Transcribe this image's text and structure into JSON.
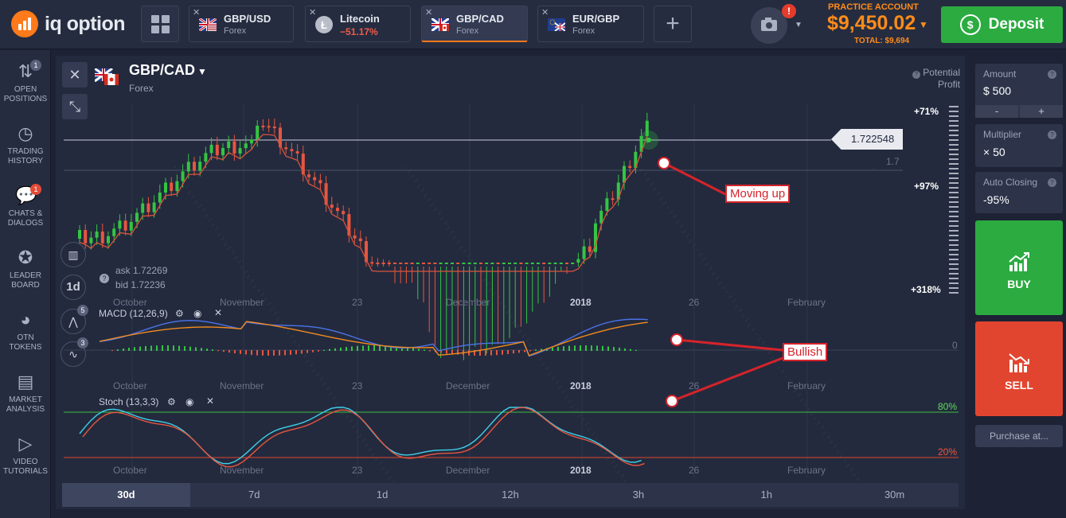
{
  "brand": {
    "name": "iq option"
  },
  "header": {
    "tabs": [
      {
        "name": "GBP/USD",
        "sub": "Forex"
      },
      {
        "name": "Litecoin",
        "sub": "−51.17%"
      },
      {
        "name": "GBP/CAD",
        "sub": "Forex"
      },
      {
        "name": "EUR/GBP",
        "sub": "Forex"
      }
    ],
    "alert_badge": "!",
    "account_label": "PRACTICE ACCOUNT",
    "balance": "$9,450.02",
    "total": "TOTAL: $9,694",
    "deposit_label": "Deposit"
  },
  "sidebar": {
    "items": [
      {
        "label": "OPEN POSITIONS",
        "icon": "arrows-icon",
        "badge": "1"
      },
      {
        "label": "TRADING HISTORY",
        "icon": "clock-history-icon",
        "badge": ""
      },
      {
        "label": "CHATS & DIALOGS",
        "icon": "chat-icon",
        "badge": "1"
      },
      {
        "label": "LEADER BOARD",
        "icon": "leader-icon",
        "badge": ""
      },
      {
        "label": "OTN TOKENS",
        "icon": "token-icon",
        "badge": ""
      },
      {
        "label": "MARKET ANALYSIS",
        "icon": "news-icon",
        "badge": ""
      },
      {
        "label": "VIDEO TUTORIALS",
        "icon": "play-icon",
        "badge": ""
      }
    ]
  },
  "chart": {
    "asset_name": "GBP/CAD",
    "asset_category": "Forex",
    "potential_profit_label": "Potential Profit",
    "current_price": "1.722548",
    "level_label": "1.7",
    "ask": "ask 1.72269",
    "bid": "bid 1.72236",
    "timeframe_btn": "1d",
    "tool_badge_1": "5",
    "tool_badge_2": "3",
    "macd_label": "MACD (12,26,9)",
    "stoch_label": "Stoch (13,3,3)",
    "macd_zero": "0",
    "stoch_high": "80%",
    "stoch_low": "20%",
    "profit_pcts": [
      "+71%",
      "+97%",
      "+318%"
    ],
    "x_axis": [
      "October",
      "November",
      "23",
      "December",
      "2018",
      "26",
      "February"
    ],
    "annotations": {
      "moving_up": "Moving up",
      "bullish": "Bullish"
    }
  },
  "timeframes": [
    "30d",
    "7d",
    "1d",
    "12h",
    "3h",
    "1h",
    "30m"
  ],
  "right_panel": {
    "amount_label": "Amount",
    "amount_value": "$  500",
    "minus": "-",
    "plus": "+",
    "multiplier_label": "Multiplier",
    "multiplier_value": "× 50",
    "auto_closing_label": "Auto Closing",
    "auto_closing_value": "-95%",
    "buy_label": "BUY",
    "sell_label": "SELL",
    "purchase_label": "Purchase at..."
  },
  "colors": {
    "accent_orange": "#ff8c1a",
    "buy_green": "#2bab40",
    "sell_red": "#e2452f",
    "callout_red": "#d6232b"
  }
}
